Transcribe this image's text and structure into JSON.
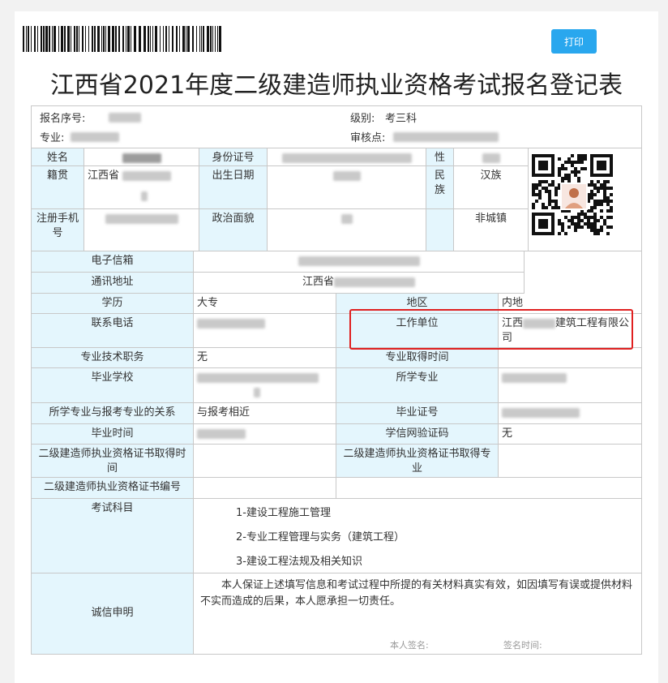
{
  "header": {
    "print_label": "打印",
    "title": "江西省2021年度二级建造师执业资格考试报名登记表"
  },
  "top_info": {
    "serial_label": "报名序号:",
    "level_label": "级别:",
    "level_value": "考三科",
    "major_label": "专业:",
    "review_label": "审核点:"
  },
  "rows": {
    "name_label": "姓名",
    "id_label": "身份证号",
    "gender_label": "性别",
    "native_label": "籍贯",
    "native_value": "江西省",
    "birth_label": "出生日期",
    "ethnic_label": "民族",
    "ethnic_value": "汉族",
    "phone_label": "注册手机号",
    "political_label": "政治面貌",
    "household_value": "非城镇",
    "email_label": "电子信箱",
    "address_label": "通讯地址",
    "address_value": "江西省",
    "edu_label": "学历",
    "edu_value": "大专",
    "region_label": "地区",
    "region_value": "内地",
    "contact_label": "联系电话",
    "work_label": "工作单位",
    "work_value_a": "江西",
    "work_value_b": "建筑工程有限公司",
    "title_label": "专业技术职务",
    "title_value": "无",
    "title_time_label": "专业取得时间",
    "school_label": "毕业学校",
    "studied_major_label": "所学专业",
    "relation_label": "所学专业与报考专业的关系",
    "relation_value": "与报考相近",
    "cert_no_label": "毕业证号",
    "grad_time_label": "毕业时间",
    "xuexin_label": "学信网验证码",
    "xuexin_value": "无",
    "cert_time_label": "二级建造师执业资格证书取得时间",
    "cert_major_label": "二级建造师执业资格证书取得专业",
    "cert_num_label": "二级建造师执业资格证书编号",
    "subjects_label": "考试科目",
    "subjects": [
      "1-建设工程施工管理",
      "2-专业工程管理与实务（建筑工程）",
      "3-建设工程法规及相关知识"
    ],
    "pledge_label": "诚信申明",
    "pledge_text": "本人保证上述填写信息和考试过程中所提的有关材料真实有效，如因填写有误或提供材料不实而造成的后果，本人愿承担一切责任。",
    "sign_label": "本人签名:",
    "sign_time_label": "签名时间:"
  },
  "colors": {
    "label_bg": "#e4f6fd",
    "button": "#29a7ee",
    "highlight": "#e02020"
  }
}
